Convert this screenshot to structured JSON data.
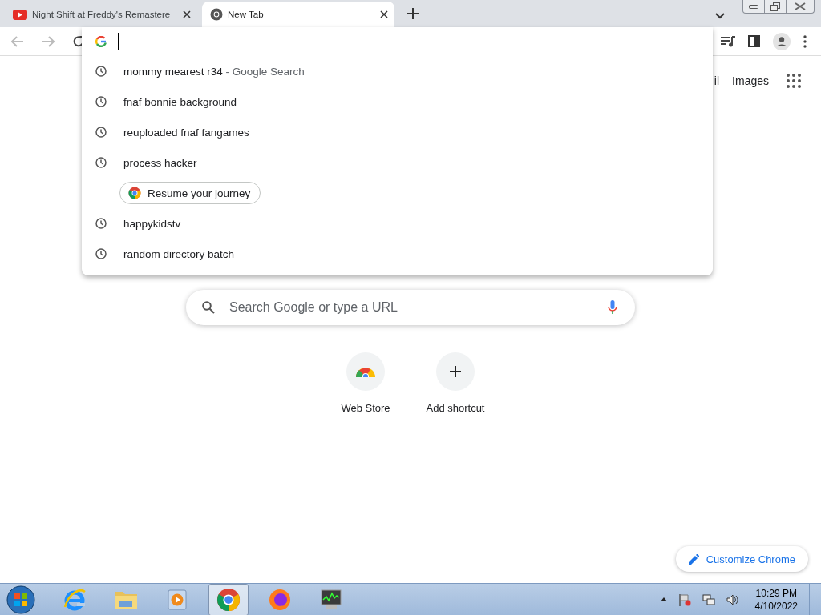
{
  "tabs": [
    {
      "title": "Night Shift at Freddy's Remastere",
      "kind": "video",
      "selected": false
    },
    {
      "title": "New Tab",
      "kind": "chrome",
      "selected": true
    }
  ],
  "suggestions": [
    {
      "kind": "history",
      "text": "mommy mearest r34",
      "suffix": "- Google Search"
    },
    {
      "kind": "history",
      "text": "fnaf bonnie background"
    },
    {
      "kind": "history",
      "text": "reuploaded fnaf fangames"
    },
    {
      "kind": "history",
      "text": "process hacker"
    },
    {
      "kind": "journey",
      "text": "Resume your journey"
    },
    {
      "kind": "history",
      "text": "happykidstv"
    },
    {
      "kind": "history",
      "text": "random directory batch"
    }
  ],
  "header_links": [
    "il",
    "Images"
  ],
  "search": {
    "placeholder": "Search Google or type a URL"
  },
  "shortcuts": [
    {
      "kind": "store",
      "label": "Web Store"
    },
    {
      "kind": "add",
      "label": "Add shortcut"
    }
  ],
  "customize": "Customize Chrome",
  "taskbar": {
    "apps": [
      {
        "kind": "ie",
        "selected": false
      },
      {
        "kind": "folder",
        "selected": false
      },
      {
        "kind": "media",
        "selected": false
      },
      {
        "kind": "chrome",
        "selected": true
      },
      {
        "kind": "firefox",
        "selected": false
      },
      {
        "kind": "monitor",
        "selected": false
      }
    ],
    "time": "10:29 PM",
    "date": "4/10/2022"
  }
}
